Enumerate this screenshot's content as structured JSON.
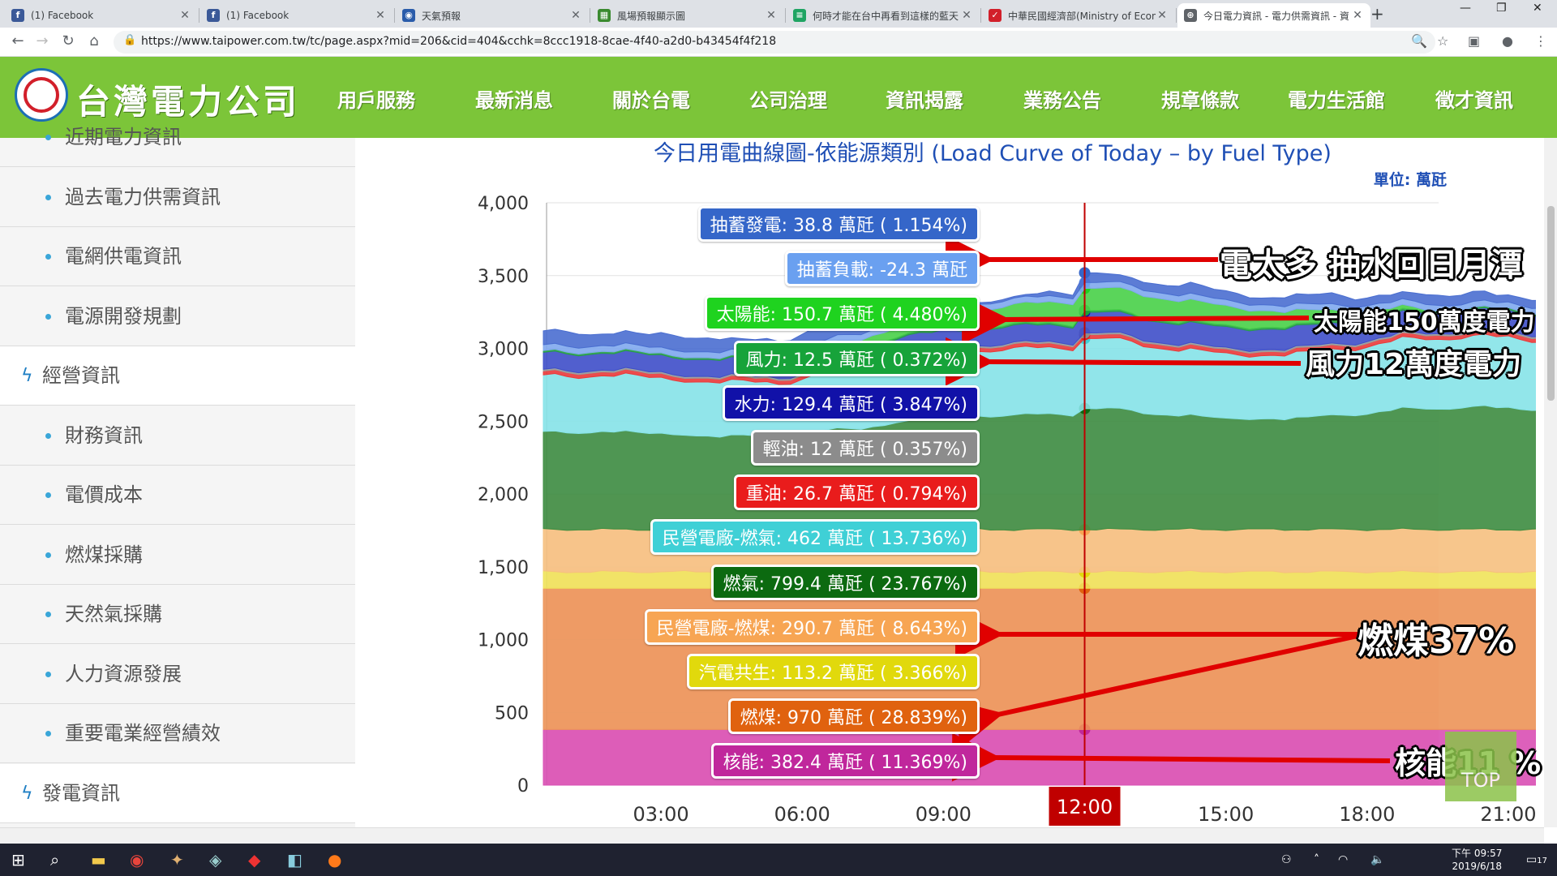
{
  "browser": {
    "tabs": [
      {
        "title": "(1) Facebook",
        "icon": "facebook-icon",
        "color": "#3b5998"
      },
      {
        "title": "(1) Facebook",
        "icon": "facebook-icon",
        "color": "#3b5998"
      },
      {
        "title": "天氣預報",
        "icon": "eye-icon",
        "color": "#2a5caa"
      },
      {
        "title": "風場預報顯示圖",
        "icon": "map-icon",
        "color": "#3a8a2f"
      },
      {
        "title": "何時才能在台中再看到這樣的藍天",
        "icon": "doc-icon",
        "color": "#1fa463"
      },
      {
        "title": "中華民國經濟部(Ministry of Economic Affairs)",
        "icon": "moea-icon",
        "color": "#d21f2a"
      },
      {
        "title": "今日電力資訊 - 電力供需資訊 - 資",
        "icon": "globe-icon",
        "color": "#5f6368"
      }
    ],
    "url": "https://www.taipower.com.tw/tc/page.aspx?mid=206&cid=404&cchk=8ccc1918-8cae-4f40-a2d0-b43454f4f218"
  },
  "header": {
    "brand": "台灣電力公司",
    "nav": [
      "用戶服務",
      "最新消息",
      "關於台電",
      "公司治理",
      "資訊揭露",
      "業務公告",
      "規章條款",
      "電力生活館",
      "徵才資訊"
    ]
  },
  "sidebar": {
    "items": [
      {
        "label": "近期電力資訊",
        "section": false
      },
      {
        "label": "過去電力供需資訊",
        "section": false
      },
      {
        "label": "電網供電資訊",
        "section": false
      },
      {
        "label": "電源開發規劃",
        "section": false
      },
      {
        "label": "經營資訊",
        "section": true
      },
      {
        "label": "財務資訊",
        "section": false
      },
      {
        "label": "電價成本",
        "section": false
      },
      {
        "label": "燃煤採購",
        "section": false
      },
      {
        "label": "天然氣採購",
        "section": false
      },
      {
        "label": "人力資源發展",
        "section": false
      },
      {
        "label": "重要電業經營績效",
        "section": false
      },
      {
        "label": "發電資訊",
        "section": true
      }
    ]
  },
  "chart_data": {
    "type": "area",
    "title": "今日用電曲線圖-依能源類別 (Load Curve of Today – by Fuel Type)",
    "unit_label": "單位: 萬瓩",
    "ylim": [
      0,
      4000
    ],
    "y_ticks": [
      "0",
      "500",
      "1,000",
      "1,500",
      "2,000",
      "2,500",
      "3,000",
      "3,500",
      "4,000"
    ],
    "x_ticks": [
      "03:00",
      "06:00",
      "09:00",
      "12:00",
      "15:00",
      "18:00",
      "21:00"
    ],
    "cursor_time": "12:00",
    "series": [
      {
        "name": "核能",
        "value": 382.4,
        "pct": "11.369%",
        "color": "#d94fb4",
        "label_color": "#c0279c"
      },
      {
        "name": "燃煤",
        "value": 970,
        "pct": "28.839%",
        "color": "#ec9458",
        "label_color": "#e0620f"
      },
      {
        "name": "汽電共生",
        "value": 113.2,
        "pct": "3.366%",
        "color": "#f0e35a",
        "label_color": "#e1d90c"
      },
      {
        "name": "民營電廠-燃煤",
        "value": 290.7,
        "pct": "8.643%",
        "color": "#f6c07f",
        "label_color": "#f7a553"
      },
      {
        "name": "燃氣",
        "value": 799.4,
        "pct": "23.767%",
        "color": "#3d8c40",
        "label_color": "#0c6a10"
      },
      {
        "name": "民營電廠-燃氣",
        "value": 462,
        "pct": "13.736%",
        "color": "#86e3e8",
        "label_color": "#3fd0d6"
      },
      {
        "name": "重油",
        "value": 26.7,
        "pct": "0.794%",
        "color": "#ea3a3a",
        "label_color": "#e91c1c"
      },
      {
        "name": "輕油",
        "value": 12,
        "pct": "0.357%",
        "color": "#9a9a9a",
        "label_color": "#8c8c8c"
      },
      {
        "name": "水力",
        "value": 129.4,
        "pct": "3.847%",
        "color": "#3f4fc9",
        "label_color": "#1111a8"
      },
      {
        "name": "風力",
        "value": 12.5,
        "pct": "0.372%",
        "color": "#27a047",
        "label_color": "#17a33a"
      },
      {
        "name": "太陽能",
        "value": 150.7,
        "pct": "4.480%",
        "color": "#48d048",
        "label_color": "#1fd31f"
      },
      {
        "name": "抽蓄負載",
        "value": -24.3,
        "pct": "",
        "color": "#7fa9ee",
        "label_color": "#6aa0f0"
      },
      {
        "name": "抽蓄發電",
        "value": 38.8,
        "pct": "1.154%",
        "color": "#4a6ed0",
        "label_color": "#3566c9"
      }
    ],
    "labels_top_to_bottom": [
      "抽蓄發電: 38.8 萬瓩 ( 1.154%)",
      "抽蓄負載: -24.3 萬瓩",
      "太陽能: 150.7 萬瓩 ( 4.480%)",
      "風力: 12.5 萬瓩 ( 0.372%)",
      "水力: 129.4 萬瓩 ( 3.847%)",
      "輕油: 12 萬瓩 ( 0.357%)",
      "重油: 26.7 萬瓩 ( 0.794%)",
      "民營電廠-燃氣: 462 萬瓩 ( 13.736%)",
      "燃氣: 799.4 萬瓩 ( 23.767%)",
      "民營電廠-燃煤: 290.7 萬瓩 ( 8.643%)",
      "汽電共生: 113.2 萬瓩 ( 3.366%)",
      "燃煤: 970 萬瓩 ( 28.839%)",
      "核能: 382.4 萬瓩 ( 11.369%)"
    ],
    "annotations": [
      "電太多 抽水回日月潭",
      "太陽能150萬度電力",
      "風力12萬度電力",
      "燃煤37%",
      "核能11 %"
    ]
  },
  "top_button": "TOP",
  "taskbar": {
    "time": "下午 09:57",
    "date": "2019/6/18",
    "notif": "17"
  }
}
